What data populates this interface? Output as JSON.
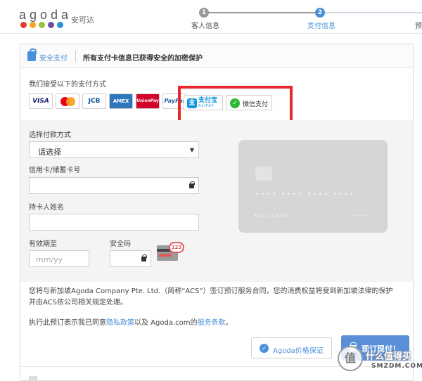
{
  "brand": {
    "logo_text": "agoda",
    "name_cn": "安可达",
    "dot_colors": [
      "#e43d30",
      "#f4a424",
      "#9ac23c",
      "#6e4ea3",
      "#2c8fd9"
    ]
  },
  "steps": [
    {
      "number": "1",
      "label": "客人信息",
      "state": "done"
    },
    {
      "number": "2",
      "label": "支付信息",
      "state": "active"
    },
    {
      "label": "预",
      "state": "upcoming"
    }
  ],
  "security": {
    "title": "安全支付",
    "message": "所有支付卡信息已获得安全的加密保护"
  },
  "payments": {
    "accept_label": "我们接受以下的支付方式",
    "cards": [
      {
        "name": "visa-logo",
        "text": "VISA",
        "color": "#1a1f71"
      },
      {
        "name": "mastercard-logo",
        "text": "",
        "color": "#eb001b"
      },
      {
        "name": "jcb-logo",
        "text": "JCB",
        "color": "#0b4ea2"
      },
      {
        "name": "amex-logo",
        "text": "AMEX",
        "color": "#2e77bc"
      },
      {
        "name": "unionpay-logo",
        "text": "UnionPay",
        "color": "#d10429"
      },
      {
        "name": "paypal-logo",
        "text": "PayPal",
        "color": "#1f64a8"
      }
    ],
    "alipay_text": "支付宝",
    "alipay_sub": "ALIPAY",
    "wechat_text": "微信支付"
  },
  "form": {
    "method_label": "选择付款方式",
    "method_value": "请选择",
    "card_number_label": "信用卡/储蓄卡号",
    "holder_label": "持卡人姓名",
    "expiry_label": "有效期至",
    "expiry_placeholder": "mm/yy",
    "cvv_label": "安全码",
    "cvv_hint": "123"
  },
  "card_preview": {
    "number_mask": "•••• •••• •••• ••••",
    "name": "FULL NAME",
    "date": "••/••"
  },
  "terms": {
    "line1": "您将与新加坡Agoda Company Pte. Ltd.（简称“ACS”）签订预订服务合同，您的消费权益将受到新加坡法律的保护",
    "line2": "并由ACS依公司相关规定处理。",
    "agree_prefix": "执行此预订表示我已同意",
    "privacy_link": "隐私政策",
    "agree_mid": "以及 Agoda.com的",
    "service_link": "服务条款",
    "agree_suffix": "。"
  },
  "actions": {
    "price_guarantee": "Agoda价格保证",
    "pay_now": "现订现付！"
  },
  "watermark": {
    "mark": "值",
    "text": "什么值得买",
    "site": "SMZDM.COM"
  },
  "colors": {
    "accent": "#4a90d9",
    "highlight_box": "#e8262c"
  }
}
